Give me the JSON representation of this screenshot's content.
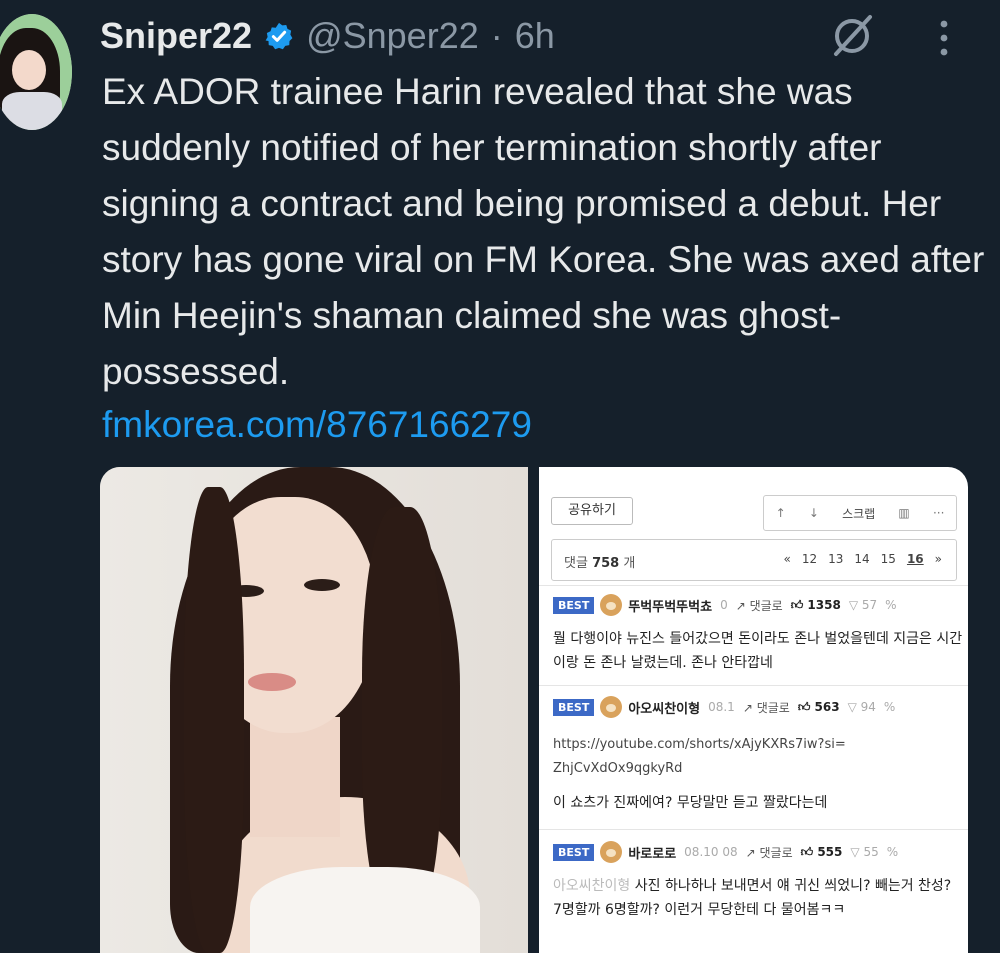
{
  "tweet": {
    "display_name": "Sniper22",
    "handle": "@Snper22",
    "separator": "·",
    "time": "6h",
    "text": "Ex ADOR trainee Harin revealed that she was suddenly notified of her termination shortly after signing a contract and being promised a debut. Her story has gone viral on FM Korea. She was axed after Min Heejin's shaman claimed she was ghost-possessed.",
    "link": "fmkorea.com/8767166279"
  },
  "screenshot": {
    "share_button": "공유하기",
    "toolbar": {
      "scrap": "스크랩"
    },
    "comment_count_label": "댓글",
    "comment_count": "758",
    "comment_count_unit": "개",
    "pager": {
      "prev": "«",
      "pages": [
        "12",
        "13",
        "14",
        "15"
      ],
      "current": "16",
      "next": "»"
    },
    "comments": [
      {
        "badge": "BEST",
        "nick": "뚜벅뚜벅뚜벅쵸",
        "meta": "0",
        "reply": "댓글로",
        "up": "1358",
        "down": "57",
        "body": "뭘 다행이야 뉴진스 들어갔으면 돈이라도 존나 벌었을텐데 지금은 시간이랑 돈 존나 날렸는데. 존나 안타깝네"
      },
      {
        "badge": "BEST",
        "nick": "아오씨찬이형",
        "meta": "08.1",
        "reply": "댓글로",
        "up": "563",
        "down": "94",
        "body_link": "https://youtube.com/shorts/xAjyKXRs7iw?si=ZhjCvXdOx9qgkyRd",
        "body": "이 쇼츠가 진짜에여? 무당말만 듣고 짤랐다는데"
      },
      {
        "badge": "BEST",
        "nick": "바로로로",
        "meta": "08.10 08",
        "reply": "댓글로",
        "up": "555",
        "down": "55",
        "mention": "아오씨찬이형",
        "body": "사진 하나하나 보내면서 얘 귀신 씌었니? 빼는거 찬성? 7명할까 6명할까? 이런거 무당한테 다 물어봄ㅋㅋ"
      }
    ]
  }
}
